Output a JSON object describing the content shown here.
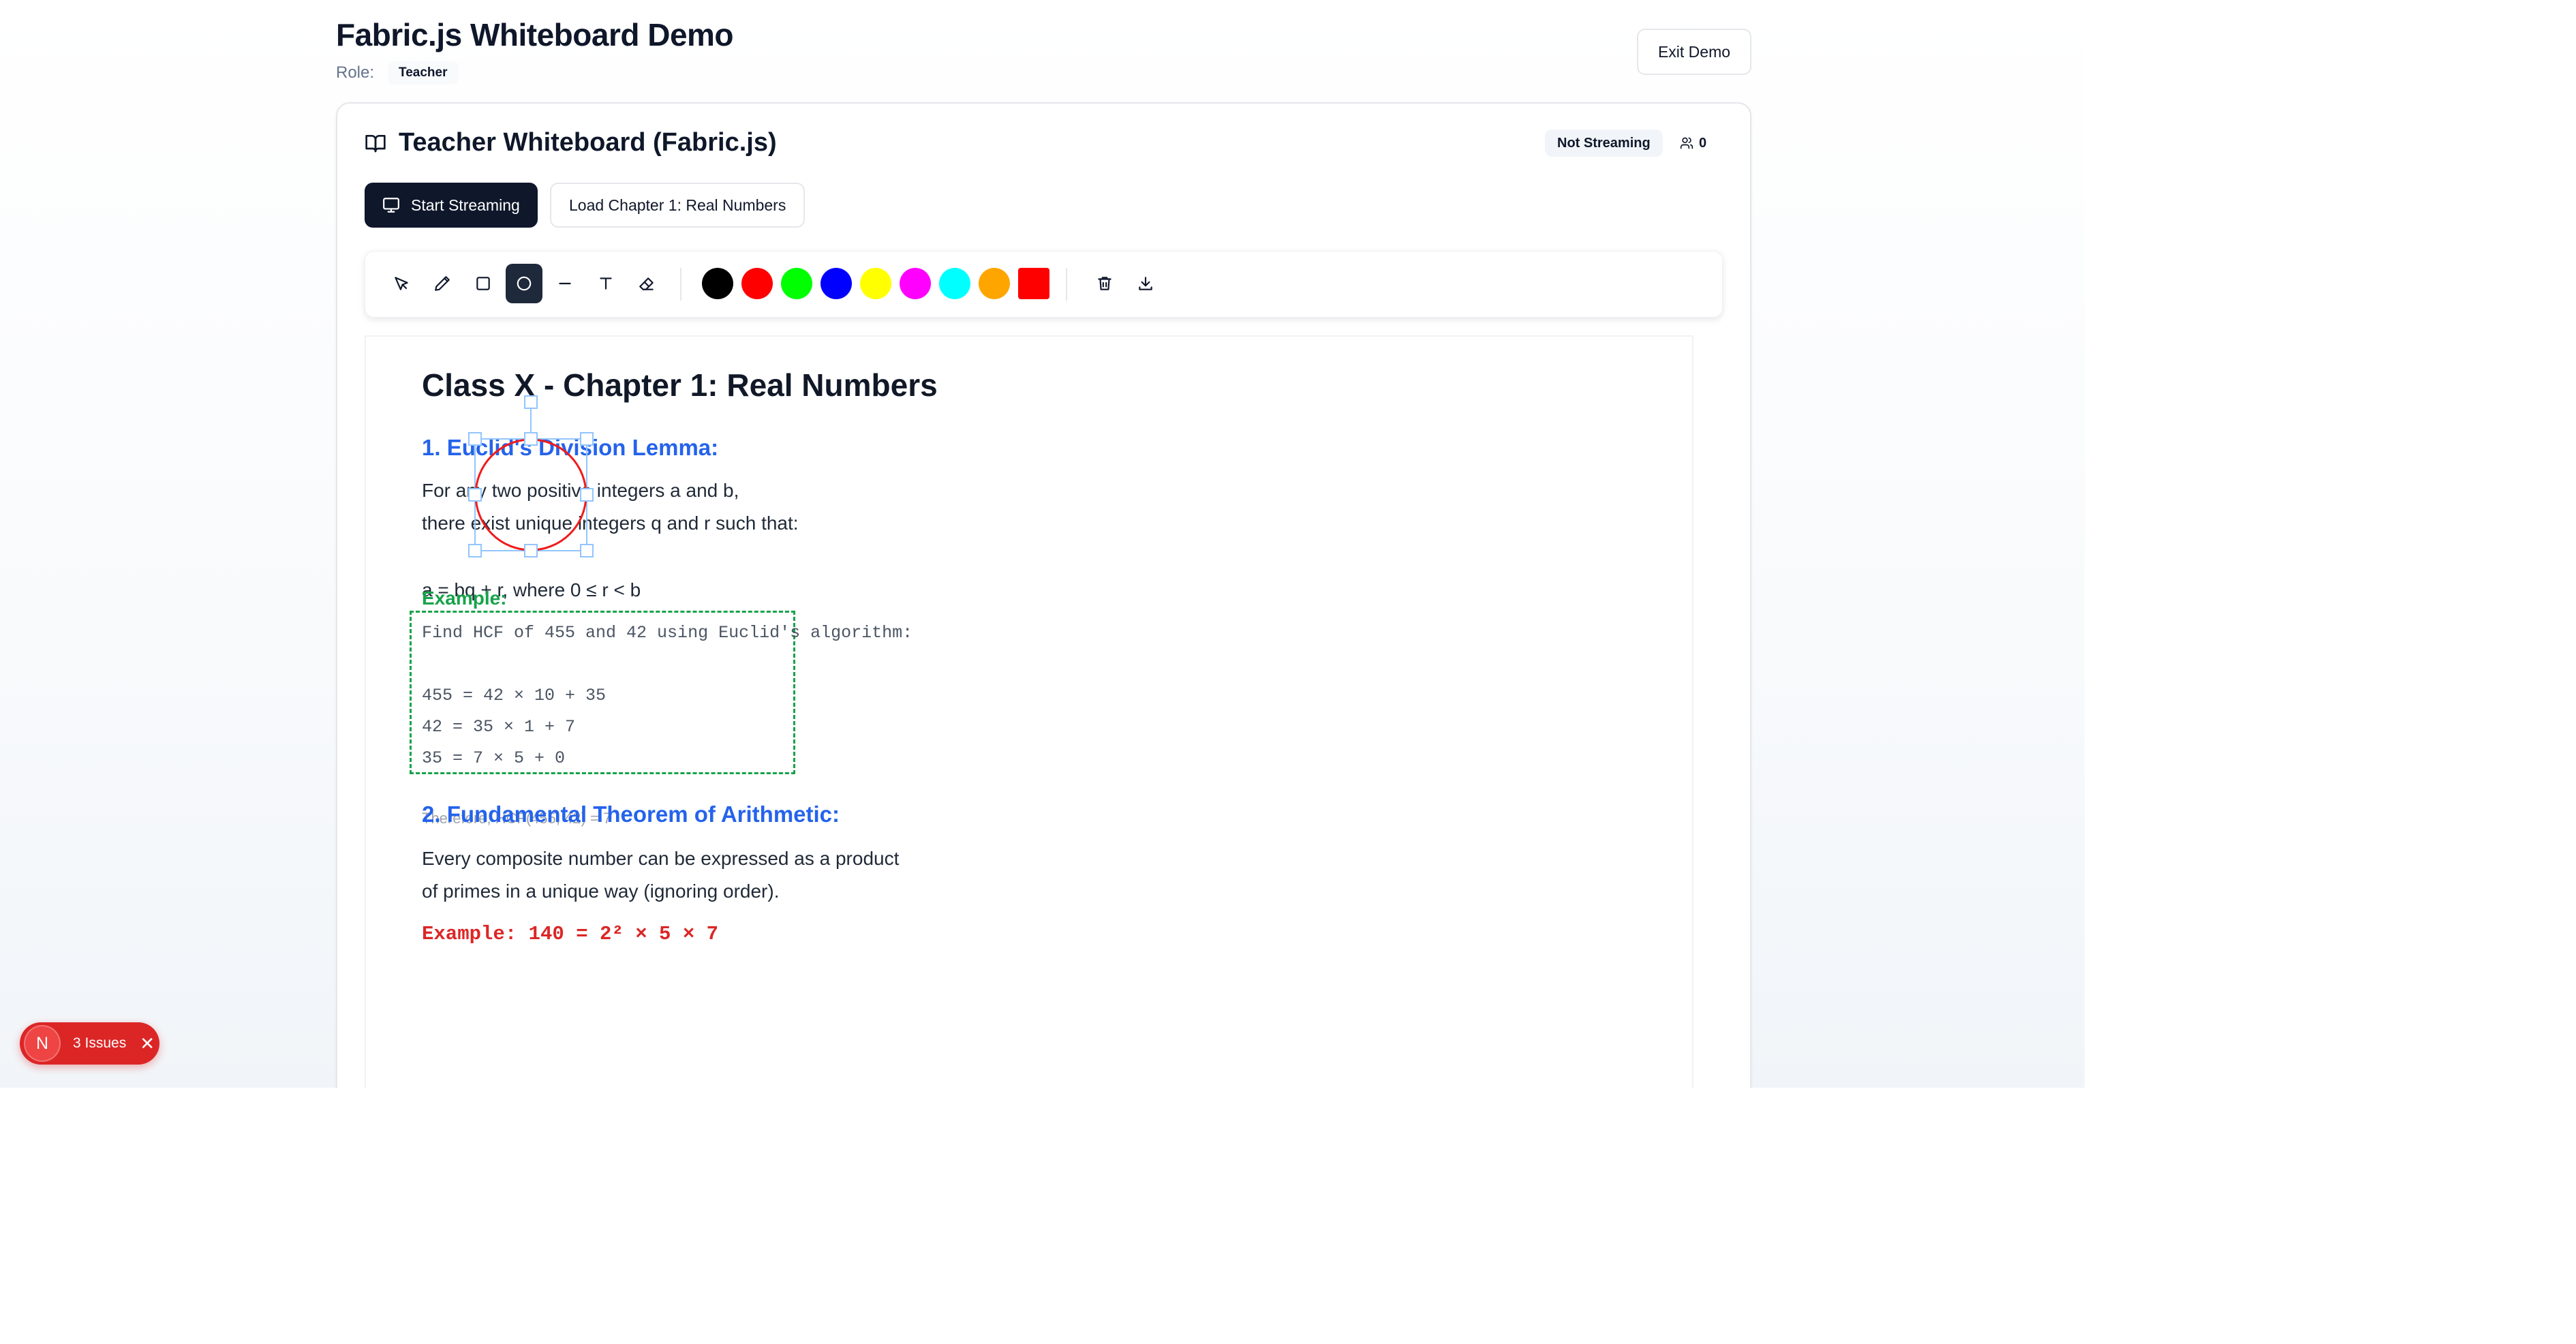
{
  "header": {
    "title": "Fabric.js Whiteboard Demo",
    "role_label": "Role:",
    "role_value": "Teacher",
    "exit_label": "Exit Demo"
  },
  "card": {
    "title": "Teacher Whiteboard (Fabric.js)",
    "status": "Not Streaming",
    "viewer_count": "0",
    "start_streaming_label": "Start Streaming",
    "load_chapter_label": "Load Chapter 1: Real Numbers"
  },
  "toolbar": {
    "tools": [
      "select-icon",
      "pencil-icon",
      "rectangle-icon",
      "circle-icon",
      "line-icon",
      "text-icon",
      "eraser-icon"
    ],
    "active_tool": "circle-icon",
    "colors": [
      "#000000",
      "#ff0000",
      "#00ff00",
      "#0000ff",
      "#ffff00",
      "#ff00ff",
      "#00ffff",
      "#ffa500"
    ],
    "current_color": "#ff0000",
    "actions": [
      "trash-icon",
      "download-icon"
    ]
  },
  "whiteboard": {
    "heading": "Class X - Chapter 1: Real Numbers",
    "section1_title": "1. Euclid's Division Lemma:",
    "section1_line1": "For any two positive integers a and b,",
    "section1_line2": "there exist unique integers q and r such that:",
    "formula": "a = bq + r, where 0 ≤ r < b",
    "example_label": "Example:",
    "example_prompt": "Find HCF of 455 and 42 using Euclid's algorithm:",
    "step1": "455 = 42 × 10 + 35",
    "step2": "42 = 35 × 1 + 7",
    "step3": "35 = 7 × 5 + 0",
    "hcf_result": "Therefore, HCF(455, 42) = 7",
    "section2_title": "2. Fundamental Theorem of Arithmetic:",
    "section2_line1": "Every composite number can be expressed as a product",
    "section2_line2": "of primes in a unique way (ignoring order).",
    "section2_example": "Example: 140 = 2² × 5 × 7"
  },
  "dev_overlay": {
    "badge_letter": "N",
    "issues_label": "3 Issues"
  }
}
